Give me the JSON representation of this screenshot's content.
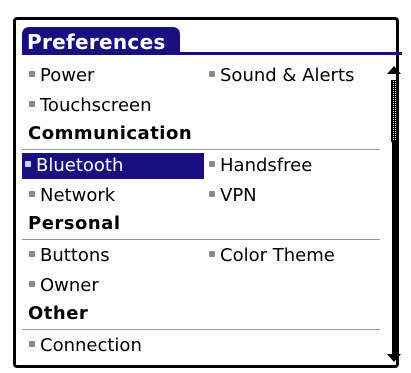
{
  "app": {
    "title": "Preferences"
  },
  "items": {
    "power": "Power",
    "sound_alerts": "Sound & Alerts",
    "touchscreen": "Touchscreen",
    "bluetooth": "Bluetooth",
    "handsfree": "Handsfree",
    "network": "Network",
    "vpn": "VPN",
    "buttons": "Buttons",
    "color_theme": "Color Theme",
    "owner": "Owner",
    "connection": "Connection"
  },
  "sections": {
    "communication": "Communication",
    "personal": "Personal",
    "other": "Other"
  },
  "selected_item": "Bluetooth",
  "colors": {
    "accent": "#1a0f80",
    "rule": "#9a9a9a",
    "bullet": "#8a8a8a"
  }
}
